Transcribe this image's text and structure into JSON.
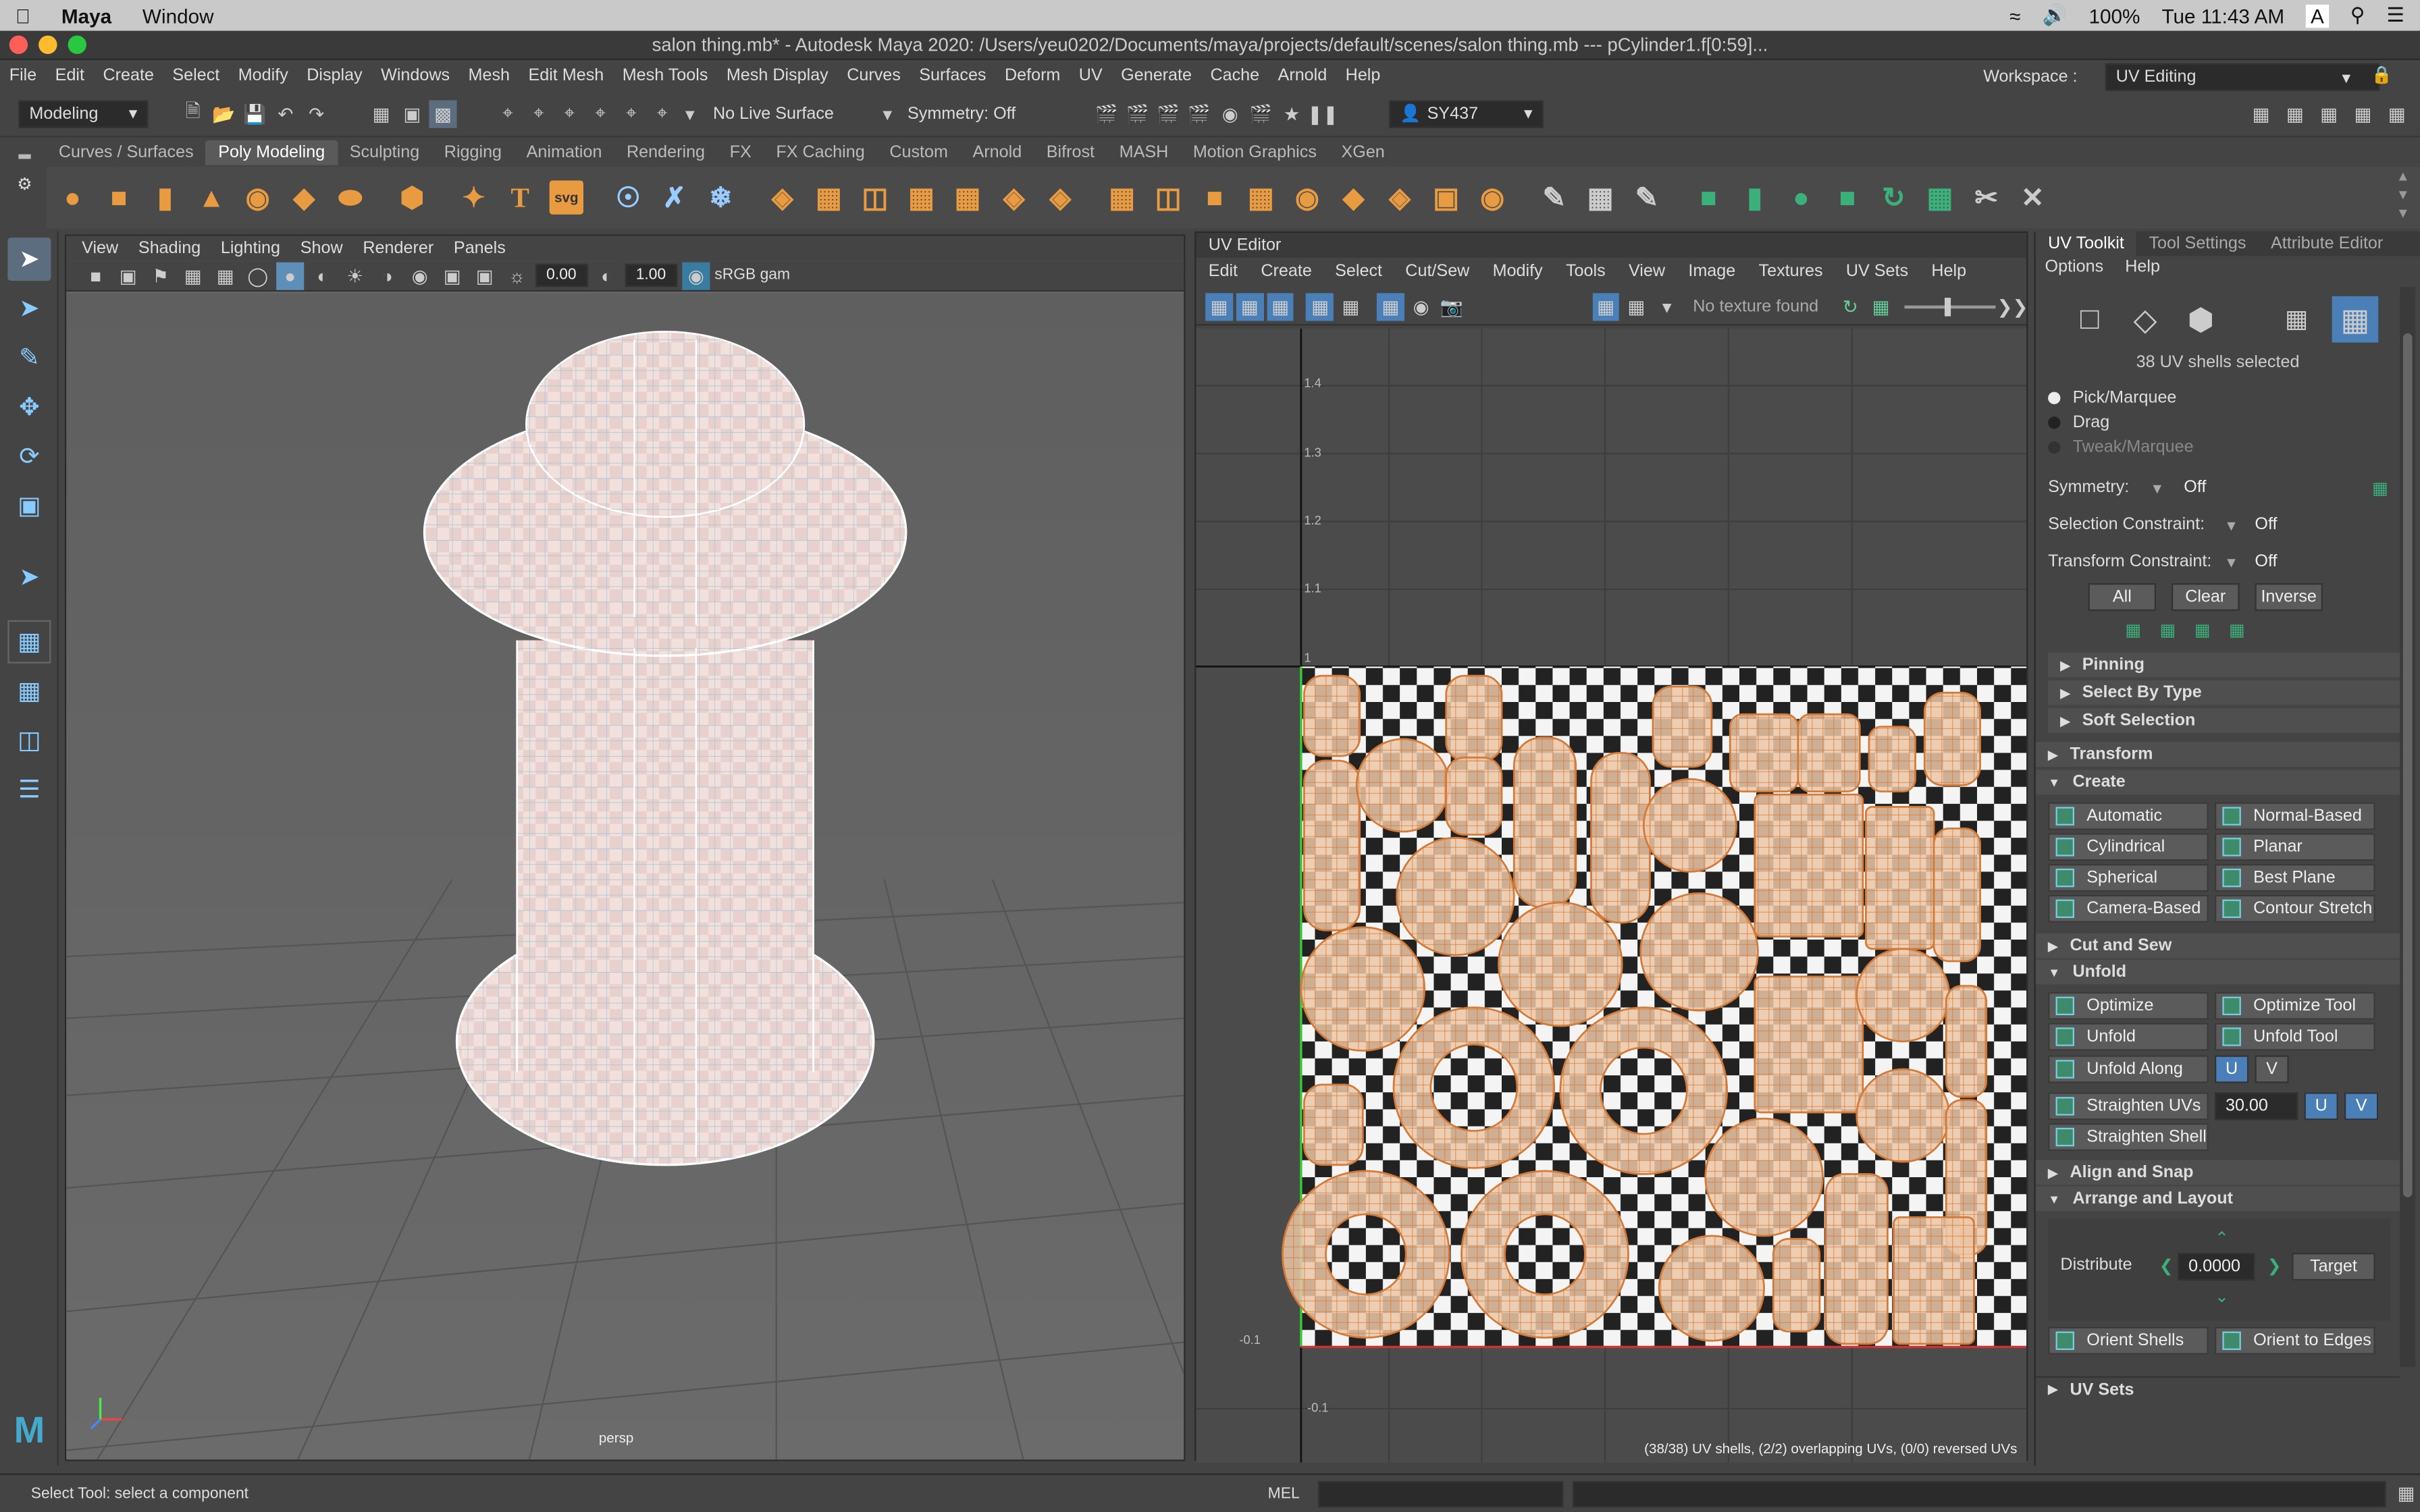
{
  "mac_menubar": {
    "app": "Maya",
    "menu": "Window",
    "battery": "100%",
    "clock": "Tue 11:43 AM",
    "status_letter": "A"
  },
  "title": "salon thing.mb* - Autodesk Maya 2020: /Users/yeu0202/Documents/maya/projects/default/scenes/salon thing.mb   ---   pCylinder1.f[0:59]...",
  "main_menu": [
    "File",
    "Edit",
    "Create",
    "Select",
    "Modify",
    "Display",
    "Windows",
    "Mesh",
    "Edit Mesh",
    "Mesh Tools",
    "Mesh Display",
    "Curves",
    "Surfaces",
    "Deform",
    "UV",
    "Generate",
    "Cache",
    "Arnold",
    "Help"
  ],
  "workspace": {
    "label": "Workspace :",
    "value": "UV Editing"
  },
  "status_line": {
    "mode": "Modeling",
    "live_surface": "No Live Surface",
    "symmetry": "Symmetry: Off",
    "user": "SY437"
  },
  "shelf_tabs": [
    "Curves / Surfaces",
    "Poly Modeling",
    "Sculpting",
    "Rigging",
    "Animation",
    "Rendering",
    "FX",
    "FX Caching",
    "Custom",
    "Arnold",
    "Bifrost",
    "MASH",
    "Motion Graphics",
    "XGen"
  ],
  "shelf_active": "Poly Modeling",
  "shelf_text_icons": {
    "text": "T",
    "svg": "svg"
  },
  "viewport": {
    "menu": [
      "View",
      "Shading",
      "Lighting",
      "Show",
      "Renderer",
      "Panels"
    ],
    "exposure": "0.00",
    "gamma": "1.00",
    "colorspace": "sRGB gam",
    "camera": "persp"
  },
  "uv_editor": {
    "title": "UV Editor",
    "menu": [
      "Edit",
      "Create",
      "Select",
      "Cut/Sew",
      "Modify",
      "Tools",
      "View",
      "Image",
      "Textures",
      "UV Sets",
      "Help"
    ],
    "texture_status": "No texture found",
    "axis_labels": [
      "1.4",
      "1.3",
      "1.2",
      "1.1",
      "1",
      "-0.1",
      "-0.1"
    ],
    "stats": "(38/38) UV shells, (2/2) overlapping UVs, (0/0) reversed UVs"
  },
  "uv_toolkit": {
    "tabs": [
      "UV Toolkit",
      "Tool Settings",
      "Attribute Editor"
    ],
    "menu": [
      "Options",
      "Help"
    ],
    "selection_info": "38 UV shells selected",
    "pick_modes": [
      "Pick/Marquee",
      "Drag",
      "Tweak/Marquee"
    ],
    "symmetry": {
      "label": "Symmetry:",
      "value": "Off"
    },
    "selection_constraint": {
      "label": "Selection Constraint:",
      "value": "Off"
    },
    "transform_constraint": {
      "label": "Transform Constraint:",
      "value": "Off"
    },
    "select_buttons": [
      "All",
      "Clear",
      "Inverse"
    ],
    "subsections": [
      "Pinning",
      "Select By Type",
      "Soft Selection"
    ],
    "transform": "Transform",
    "create": {
      "title": "Create",
      "buttons": [
        "Automatic",
        "Normal-Based",
        "Cylindrical",
        "Planar",
        "Spherical",
        "Best Plane",
        "Camera-Based",
        "Contour Stretch"
      ]
    },
    "cut_and_sew": "Cut and Sew",
    "unfold": {
      "title": "Unfold",
      "buttons": [
        "Optimize",
        "Optimize Tool",
        "Unfold",
        "Unfold Tool"
      ],
      "unfold_along": "Unfold Along",
      "u": "U",
      "v": "V",
      "straighten_uvs": "Straighten UVs",
      "straighten_value": "30.00",
      "straighten_shell": "Straighten Shell"
    },
    "align_and_snap": "Align and Snap",
    "arrange": {
      "title": "Arrange and Layout",
      "distribute": "Distribute",
      "distribute_value": "0.0000",
      "target": "Target",
      "orient_shells": "Orient Shells",
      "orient_to_edges": "Orient to Edges"
    },
    "uv_sets": "UV Sets"
  },
  "help_line": {
    "text": "Select Tool: select a component",
    "mel": "MEL"
  }
}
